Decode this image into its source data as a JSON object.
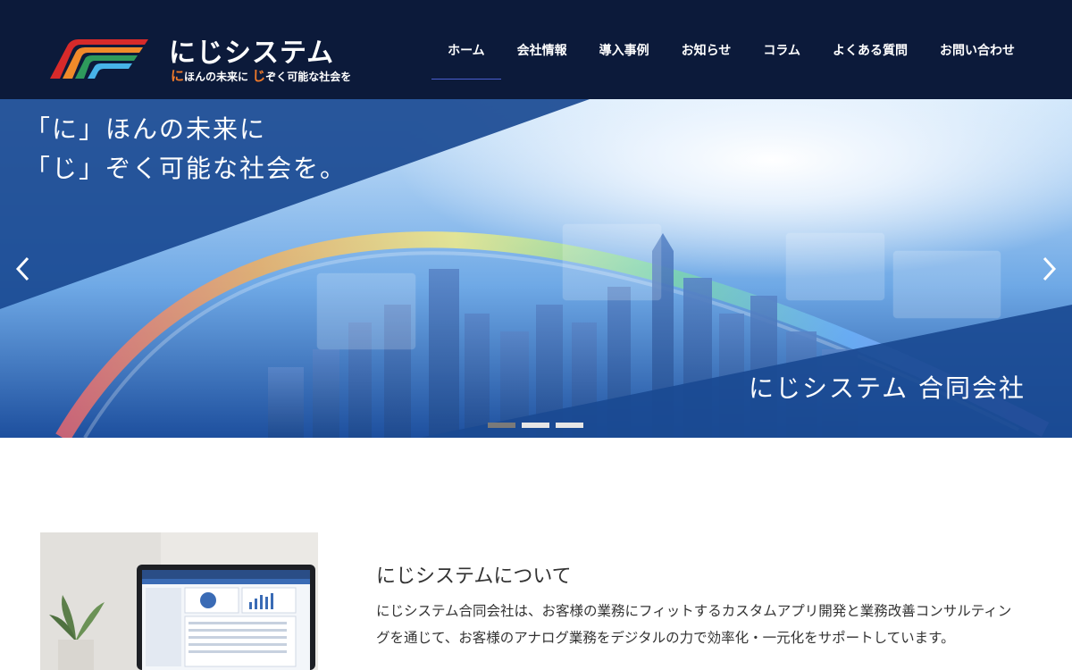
{
  "header": {
    "logo": {
      "title": "にじシステム",
      "sub_hl1": "に",
      "sub_text1": "ほんの未来に",
      "sub_hl2": "じ",
      "sub_text2": "ぞく可能な社会を"
    },
    "nav": [
      {
        "label": "ホーム",
        "active": true
      },
      {
        "label": "会社情報"
      },
      {
        "label": "導入事例"
      },
      {
        "label": "お知らせ"
      },
      {
        "label": "コラム"
      },
      {
        "label": "よくある質問"
      },
      {
        "label": "お問い合わせ"
      }
    ]
  },
  "hero": {
    "catch_line1": "「に」ほんの未来に",
    "catch_line2": "「じ」ぞく可能な社会を。",
    "company_name": "にじシステム 合同会社",
    "prev_icon": "chevron-left-icon",
    "next_icon": "chevron-right-icon",
    "slides": 3,
    "active_slide": 1
  },
  "about": {
    "title": "にじシステムについて",
    "text": "にじシステム合同会社は、お客様の業務にフィットするカスタムアプリ開発と業務改善コンサルティングを通じて、お客様のアナログ業務をデジタルの力で効率化・一元化をサポートしています。"
  },
  "colors": {
    "header_bg": "#0c1a3a",
    "nav_text": "#ffffff",
    "active_underline": "#4a5fd0",
    "logo_accent": "#f07a2a",
    "hero_blue": "#1c4f98"
  }
}
